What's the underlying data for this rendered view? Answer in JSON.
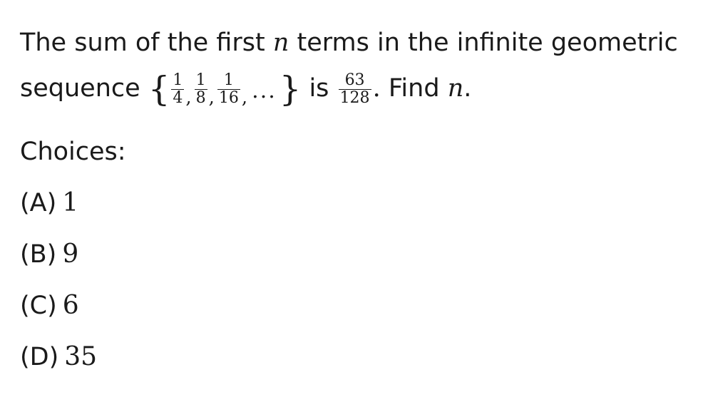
{
  "question": {
    "line1": {
      "text_before": "The sum of the first",
      "var": "n",
      "text_after": "terms in the infinite geometric"
    },
    "line2": {
      "text_before": "sequence",
      "brace_open": "{",
      "frac1": {
        "num": "1",
        "den": "4"
      },
      "frac2": {
        "num": "1",
        "den": "8"
      },
      "frac3": {
        "num": "1",
        "den": "16"
      },
      "comma": ",",
      "ellipsis": "...",
      "brace_close": "}",
      "text_is": "is",
      "sum_frac": {
        "num": "63",
        "den": "128"
      },
      "period": ".",
      "text_find": "Find",
      "var": "n",
      "end_period": "."
    }
  },
  "choices_heading": "Choices:",
  "choices": [
    {
      "label": "(A)",
      "value": "1"
    },
    {
      "label": "(B)",
      "value": "9"
    },
    {
      "label": "(C)",
      "value": "6"
    },
    {
      "label": "(D)",
      "value": "35"
    }
  ]
}
